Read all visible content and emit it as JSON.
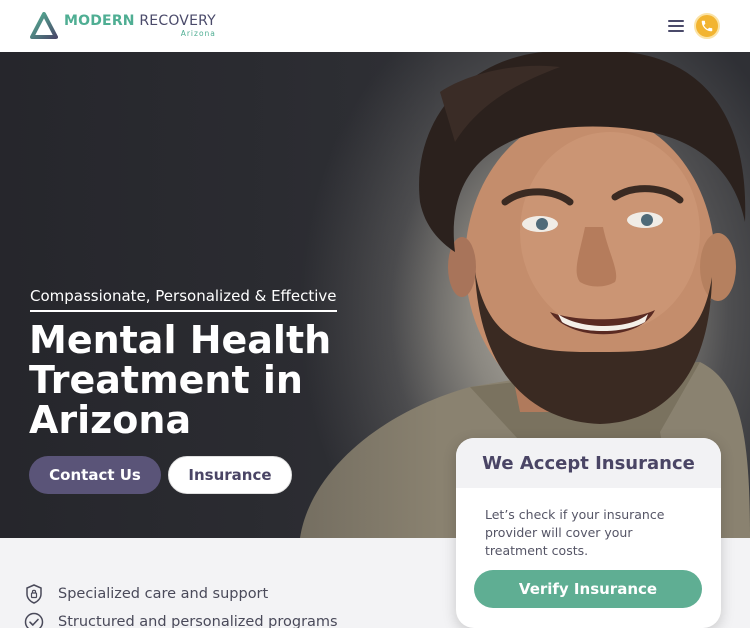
{
  "header": {
    "logo_main_a": "MODERN",
    "logo_main_b": "RECOVERY",
    "logo_sub": "Arizona",
    "menu_icon": "hamburger-menu-icon",
    "phone_icon": "phone-icon"
  },
  "hero": {
    "tagline": "Compassionate, Personalized & Effective",
    "title": "Mental Health Treatment in Arizona",
    "contact_label": "Contact Us",
    "insurance_label": "Insurance"
  },
  "insurance_card": {
    "heading": "We Accept Insurance",
    "text": "Let’s check if your insurance provider will cover your treatment costs.",
    "button_label": "Verify Insurance"
  },
  "features": [
    {
      "icon": "shield-lock-icon",
      "label": "Specialized care and support"
    },
    {
      "icon": "check-circle-icon",
      "label": "Structured and personalized programs"
    }
  ],
  "colors": {
    "accent_green": "#5fae93",
    "accent_purple": "#5a5478",
    "phone_yellow": "#f2b431"
  }
}
